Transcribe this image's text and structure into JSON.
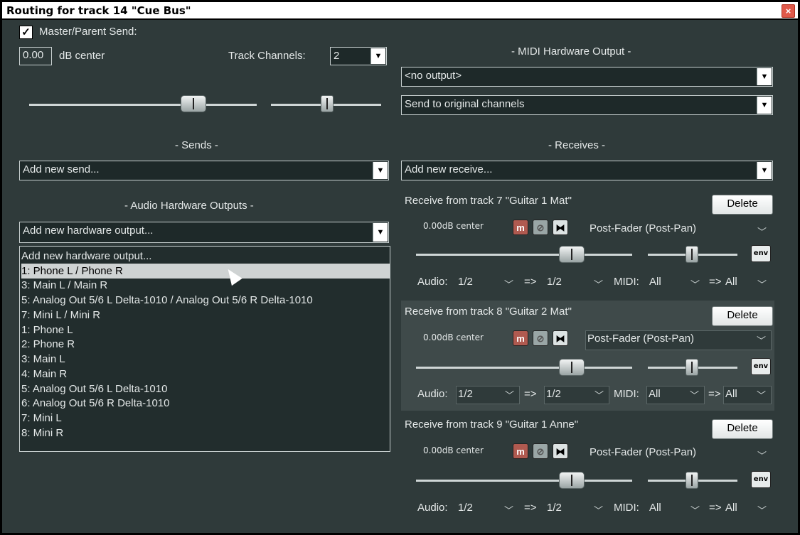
{
  "window": {
    "title": "Routing for track 14 \"Cue Bus\"",
    "close_label": "×"
  },
  "master": {
    "checkbox_label": "Master/Parent Send:",
    "checked_mark": "✓",
    "volume_value": "0.00",
    "db_label": "dB  center",
    "track_channels_label": "Track Channels:",
    "track_channels_value": "2"
  },
  "midi_hw": {
    "header": "- MIDI Hardware Output -",
    "output_value": "<no output>",
    "channel_value": "Send to original channels"
  },
  "sends": {
    "header": "- Sends -",
    "add_value": "Add new send..."
  },
  "receives": {
    "header": "- Receives -",
    "add_value": "Add new receive...",
    "items": [
      {
        "title": "Receive from track 7 \"Guitar 1 Mat\"",
        "delete_label": "Delete",
        "vol": "0.00dB center",
        "mute": "m",
        "phase": "⊘",
        "mono": "⧓",
        "mode": "Post-Fader (Post-Pan)",
        "env": "env",
        "audio_label": "Audio:",
        "audio_src": "1/2",
        "arrow1": "=>",
        "audio_dst": "1/2",
        "midi_label": "MIDI:",
        "midi_src": "All",
        "arrow2": "=>",
        "midi_dst": "All"
      },
      {
        "title": "Receive from track 8 \"Guitar 2 Mat\"",
        "delete_label": "Delete",
        "vol": "0.00dB center",
        "mute": "m",
        "phase": "⊘",
        "mono": "⧓",
        "mode": "Post-Fader (Post-Pan)",
        "env": "env",
        "audio_label": "Audio:",
        "audio_src": "1/2",
        "arrow1": "=>",
        "audio_dst": "1/2",
        "midi_label": "MIDI:",
        "midi_src": "All",
        "arrow2": "=>",
        "midi_dst": "All"
      },
      {
        "title": "Receive from track 9 \"Guitar 1 Anne\"",
        "delete_label": "Delete",
        "vol": "0.00dB center",
        "mute": "m",
        "phase": "⊘",
        "mono": "⧓",
        "mode": "Post-Fader (Post-Pan)",
        "env": "env",
        "audio_label": "Audio:",
        "audio_src": "1/2",
        "arrow1": "=>",
        "audio_dst": "1/2",
        "midi_label": "MIDI:",
        "midi_src": "All",
        "arrow2": "=>",
        "midi_dst": "All"
      }
    ]
  },
  "audio_hw": {
    "header": "- Audio Hardware Outputs -",
    "add_value": "Add new hardware output...",
    "options": [
      "Add new hardware output...",
      "1: Phone L / Phone R",
      "3: Main L / Main R",
      "5: Analog Out 5/6 L Delta-1010 / Analog Out 5/6 R Delta-1010",
      "7: Mini L / Mini R",
      "1: Phone L",
      "2: Phone R",
      "3: Main L",
      "4: Main R",
      "5: Analog Out 5/6 L Delta-1010",
      "6: Analog Out 5/6 R Delta-1010",
      "7: Mini L",
      "8: Mini R"
    ],
    "highlighted_option": "1: Phone L / Phone R"
  },
  "icons": {
    "dropdown": "chevron-down-icon",
    "close": "close-icon",
    "cursor": "mouse-pointer-icon"
  }
}
